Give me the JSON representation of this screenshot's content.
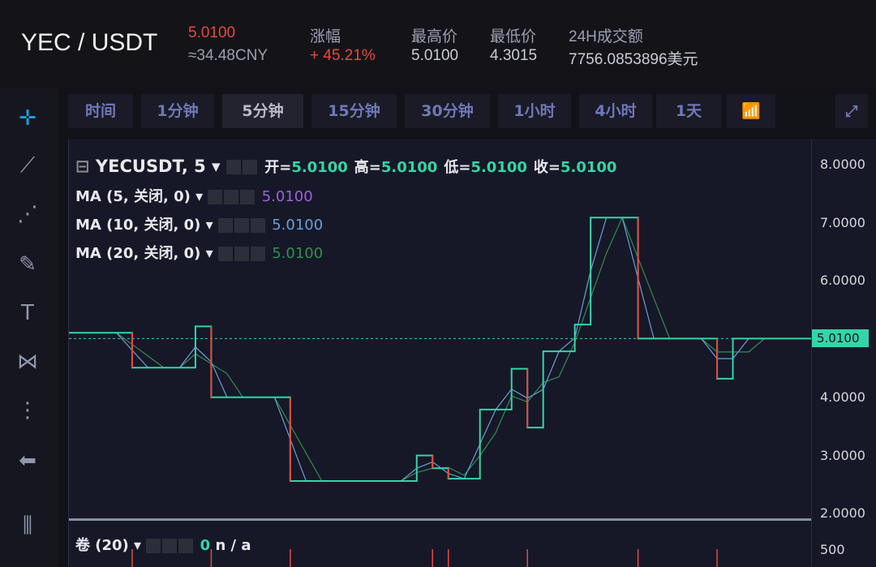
{
  "header": {
    "pair": "YEC / USDT",
    "price": "5.0100",
    "price_cny": "≈34.48CNY",
    "stats": [
      {
        "label": "涨幅",
        "value": "+ 45.21%",
        "color": "#e5483f"
      },
      {
        "label": "最高价",
        "value": "5.0100"
      },
      {
        "label": "最低价",
        "value": "4.3015"
      },
      {
        "label": "24H成交额",
        "value": "7756.0853896美元"
      }
    ]
  },
  "sidebar": {
    "tools": [
      "crosshair-icon",
      "trendline-icon",
      "fib-icon",
      "brush-icon",
      "text-icon",
      "pattern-icon",
      "measure-icon",
      "back-arrow-icon",
      "candles-icon"
    ]
  },
  "timeframes": [
    "时间",
    "1分钟",
    "5分钟",
    "15分钟",
    "30分钟",
    "1小时",
    "4小时",
    "1天"
  ],
  "active_timeframe": "5分钟",
  "legend": {
    "symbol": "YECUSDT, 5",
    "ohlc": [
      {
        "k": "开=",
        "v": "5.0100"
      },
      {
        "k": "高=",
        "v": "5.0100"
      },
      {
        "k": "低=",
        "v": "5.0100"
      },
      {
        "k": "收=",
        "v": "5.0100"
      }
    ],
    "ma": [
      {
        "label": "MA (5, 关闭, 0)",
        "value": "5.0100",
        "color": "#a35ee0"
      },
      {
        "label": "MA (10, 关闭, 0)",
        "value": "5.0100",
        "color": "#6b9ed8"
      },
      {
        "label": "MA (20, 关闭, 0)",
        "value": "5.0100",
        "color": "#2f8f4f"
      }
    ],
    "volume": {
      "label": "卷 (20)",
      "value": "0",
      "na": "n / a"
    }
  },
  "colors": {
    "up": "#32d6a6",
    "down": "#e5483f",
    "accent": "#1e9bd8"
  },
  "chart_data": {
    "type": "line",
    "ylim": [
      2,
      8
    ],
    "y_ticks": [
      "8.0000",
      "7.0000",
      "6.0000",
      "5.0000",
      "4.0000",
      "3.0000",
      "2.0000"
    ],
    "last_price": "5.0100",
    "volume_tick": "500",
    "close": [
      5.11,
      5.11,
      5.11,
      5.11,
      4.51,
      4.51,
      4.51,
      4.51,
      5.22,
      4.0,
      4.0,
      4.0,
      4.0,
      4.0,
      2.56,
      2.56,
      2.56,
      2.56,
      2.56,
      2.56,
      2.56,
      2.56,
      3.0,
      2.78,
      2.6,
      2.6,
      3.79,
      3.79,
      4.49,
      3.48,
      4.79,
      4.79,
      5.25,
      7.09,
      7.09,
      7.09,
      5.01,
      5.01,
      5.01,
      5.01,
      5.01,
      4.32,
      5.01,
      5.01,
      5.01,
      5.01,
      5.01,
      5.01
    ]
  }
}
